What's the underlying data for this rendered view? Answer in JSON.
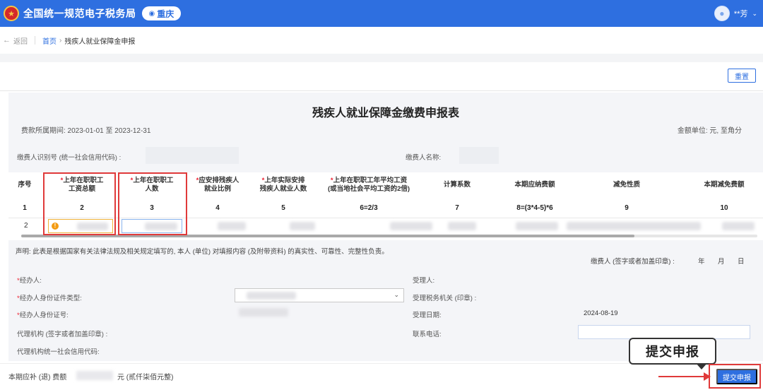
{
  "header": {
    "title": "全国统一规范电子税务局",
    "region": "重庆",
    "user": "**芳"
  },
  "breadcrumb": {
    "back": "返回",
    "home": "首页",
    "current": "残疾人就业保障金申报"
  },
  "toolbar": {
    "reset_label": "重置"
  },
  "form": {
    "title": "残疾人就业保障金缴费申报表",
    "period": "费款所属期间:  2023-01-01 至 2023-12-31",
    "unit": "金额单位: 元, 至角分",
    "payer_id_label": "缴费人识别号 (统一社会信用代码) :",
    "payer_name_label": "缴费人名称:"
  },
  "table": {
    "headers": [
      {
        "required": false,
        "text": "序号"
      },
      {
        "required": true,
        "text": "上年在职职工\n工资总额"
      },
      {
        "required": true,
        "text": "上年在职职工\n人数"
      },
      {
        "required": true,
        "text": "应安排残疾人\n就业比例"
      },
      {
        "required": true,
        "text": "上年实际安排\n残疾人就业人数"
      },
      {
        "required": true,
        "text": "上年在职职工年平均工资\n(或当地社会平均工资的2倍)"
      },
      {
        "required": false,
        "text": "计算系数"
      },
      {
        "required": false,
        "text": "本期应纳费额"
      },
      {
        "required": false,
        "text": "减免性质"
      },
      {
        "required": false,
        "text": "本期减免费额"
      }
    ],
    "numbers": [
      "1",
      "2",
      "3",
      "4",
      "5",
      "6=2/3",
      "7",
      "8=(3*4-5)*6",
      "9",
      "10"
    ],
    "row_index": "2",
    "required_mark": "*"
  },
  "declaration": {
    "statement": "声明: 此表是根据国家有关法律法规及相关规定填写的, 本人 (单位) 对填报内容 (及附带资料) 的真实性、可靠性、完整性负责。",
    "signer": "缴费人 (签字或者加盖印章) :",
    "year": "年",
    "month": "月",
    "day": "日"
  },
  "agent": {
    "handler": "经办人:",
    "id_type": "经办人身份证件类型:",
    "id_number": "经办人身份证号:",
    "agency": "代理机构 (签字或者加盖印章) :",
    "agency_code": "代理机构统一社会信用代码:",
    "receiver": "受理人:",
    "tax_office": "受理税务机关 (印章) :",
    "accept_date_label": "受理日期:",
    "accept_date": "2024-08-19",
    "phone": "联系电话:"
  },
  "footer": {
    "amount_prefix": "本期应补 (退) 费额",
    "amount_suffix": "元  (贰仟柒佰元整)",
    "submit_label": "提交申报"
  },
  "callout": {
    "text": "提交申报"
  },
  "colors": {
    "brand": "#2e6fe0",
    "highlight": "#e03a3a"
  },
  "icons": {
    "logo": "tax-emblem-icon",
    "region": "location-pin-icon",
    "user": "user-avatar-icon"
  }
}
